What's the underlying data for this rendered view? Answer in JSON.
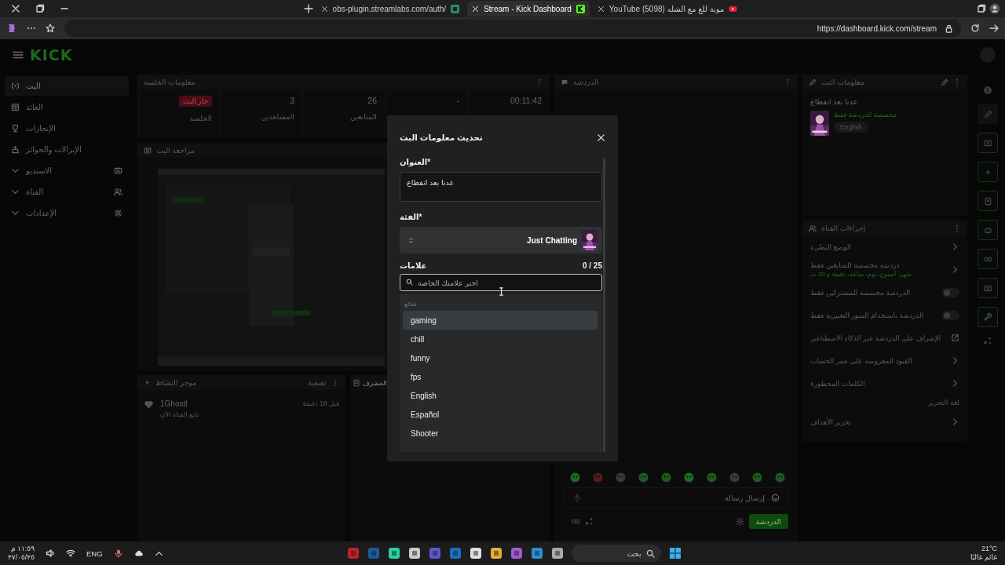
{
  "browser": {
    "tabs": [
      {
        "title": "YouTube (5098) موية للع مع الشله",
        "selected": false,
        "kind": "youtube"
      },
      {
        "title": "Stream - Kick Dashboard",
        "selected": true,
        "kind": "kick"
      },
      {
        "title": "obs-plugin.streamlabs.com/auth/",
        "selected": false,
        "kind": "streamlabs"
      }
    ],
    "url": "https://dashboard.kick.com/stream"
  },
  "sidebar": {
    "logo": "KICK",
    "items": [
      {
        "label": "البث",
        "kind": "link",
        "selected": true
      },
      {
        "label": "العائد",
        "kind": "link",
        "selected": false
      },
      {
        "label": "الإنجازات",
        "kind": "link",
        "selected": false
      },
      {
        "label": "الإنزالات والجوائز",
        "kind": "link",
        "selected": false
      },
      {
        "label": "الاستديو",
        "kind": "group",
        "selected": false,
        "expanded": false
      },
      {
        "label": "القناة",
        "kind": "group",
        "selected": false,
        "expanded": false
      },
      {
        "label": "الإعدادات",
        "kind": "group",
        "selected": false,
        "expanded": false
      }
    ]
  },
  "session": {
    "title": "معلومات الجلسة",
    "stats": [
      {
        "kind": "number",
        "value": "00:11:42"
      },
      {
        "kind": "number",
        "value": "-"
      },
      {
        "kind": "number",
        "value": "26",
        "label": "المتابعين"
      },
      {
        "kind": "number",
        "value": "3",
        "label": "المشاهدين"
      },
      {
        "kind": "badge",
        "value": "جار البث",
        "label": "الجلسة"
      }
    ]
  },
  "preview": {
    "title": "مراجعة البث",
    "kind": "picture"
  },
  "activity": {
    "title": "موجز النشاط",
    "filter": "تصفية",
    "events": [
      {
        "user": "1Ghostl",
        "action": "تابع القناة الآن",
        "time": "قبل 18 دقيقة"
      }
    ]
  },
  "moderation": {
    "title": "المشرف"
  },
  "chat": {
    "title": "الدردشة",
    "placeholder": "إرسال رسالة",
    "send": "الدردشة"
  },
  "stream_info": {
    "title": "معلومات البث",
    "stream_title": "عدنا بعد انقطاع",
    "subtitle": "مخصصة للدردشة فقط",
    "tags": [
      "English"
    ]
  },
  "channel_actions": {
    "title": "إجراءات القناة",
    "items": [
      {
        "kind": "link",
        "label": "الوضع البطيء"
      },
      {
        "kind": "link",
        "label": "دردشة مخصصة للمتابعين فقط",
        "detail": "شهر، أسبوع، يوم، ساعة، دقيقة و 30 ث"
      },
      {
        "kind": "toggle",
        "label": "الدردشة مخصصة للمشتركين فقط",
        "on": false
      },
      {
        "kind": "toggle",
        "label": "الدردشة باستخدام الصور التعبيرية فقط",
        "on": false
      },
      {
        "kind": "external",
        "label": "الإشراف على الدردشة عبر الذكاء الاصطناعي"
      },
      {
        "kind": "link",
        "label": "القيود المفروضة على عمر الحساب"
      },
      {
        "kind": "link",
        "label": "الكلمات المحظورة"
      },
      {
        "kind": "note",
        "label": "لغة التحرير"
      },
      {
        "kind": "link",
        "label": "تحرير الأهداف"
      }
    ]
  },
  "modal": {
    "title": "تحديث معلومات البث",
    "title_label": "العنوان*",
    "title_value": "عدنا بعد انقطاع",
    "category_label": "الفئة*",
    "category": "Just Chatting",
    "tags_label": "علامات",
    "tags_count": "0 / 25",
    "tag_search_placeholder": "اختر علامتك الخاصة",
    "suggestions_heading": "شائع",
    "suggestions": [
      {
        "label": "gaming",
        "selected": true
      },
      {
        "label": "chill",
        "selected": false
      },
      {
        "label": "funny",
        "selected": false
      },
      {
        "label": "fps",
        "selected": false
      },
      {
        "label": "English",
        "selected": false
      },
      {
        "label": "Español",
        "selected": false
      },
      {
        "label": "Shooter",
        "selected": false
      }
    ]
  },
  "taskbar": {
    "time": "١١:٥٩ م",
    "date": "٢٧/٠٥/٢٥",
    "language": "ENG",
    "search_placeholder": "بحث",
    "temperature": "21°C",
    "weather": "غائم غالبًا"
  }
}
